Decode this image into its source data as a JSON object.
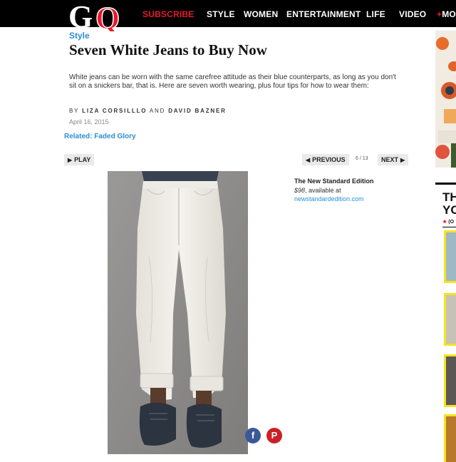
{
  "nav": {
    "logo_text": "GQ",
    "subscribe": "SUBSCRIBE",
    "items": [
      "STYLE",
      "WOMEN",
      "ENTERTAINMENT",
      "LIFE",
      "VIDEO"
    ],
    "more_plus": "+",
    "more_label": "MO"
  },
  "article": {
    "section": "Style",
    "title": "Seven White Jeans to Buy Now",
    "dek": "White jeans can be worn with the same carefree attitude as their blue counterparts, as long as you don't sit on a snickers bar, that is. Here are seven worth wearing, plus four tips for how to wear them:",
    "byline_prefix": "BY",
    "author1": "LIZA CORSILLLO",
    "byline_and": "AND",
    "author2": "DAVID BAZNER",
    "date": "April 16, 2015",
    "related": "Related: Faded Glory"
  },
  "slideshow": {
    "play_label": "PLAY",
    "previous_label": "PREVIOUS",
    "counter": "6 / 13",
    "next_label": "NEXT",
    "caption_title": "The New Standard Edition",
    "caption_price": "$98",
    "caption_suffix": ", available at",
    "caption_link": "newstandardedition.com"
  },
  "share": {
    "facebook": "f",
    "pinterest": "P"
  },
  "rail": {
    "heading_line1": "TH",
    "heading_line2": "YO",
    "small_star": "★",
    "small_text": "(O"
  },
  "colors": {
    "accent_red": "#e8192c",
    "link_blue": "#2a8fd6",
    "nav_bg": "#000000",
    "facebook": "#3b5998",
    "pinterest": "#cb2027",
    "rail_highlight": "#f5e31f"
  }
}
